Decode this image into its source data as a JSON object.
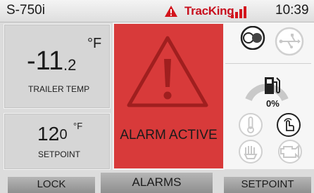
{
  "status_bar": {
    "model": "S-750i",
    "brand": "TracKing",
    "time": "10:39"
  },
  "trailer_temp": {
    "value_whole": "-11",
    "value_decimal": ".2",
    "unit": "°F",
    "label": "TRAILER TEMP"
  },
  "setpoint": {
    "value_whole": "12",
    "value_decimal": ".0",
    "unit": "°F",
    "label": "SETPOINT"
  },
  "alarm": {
    "text": "ALARM ACTIVE"
  },
  "fuel": {
    "percent": "0%",
    "level": 0
  },
  "icons": {
    "status_bar": [
      "alert-triangle-icon",
      "signal-bars-icon"
    ],
    "right_panel": [
      "toggle-icon",
      "usb-icon",
      "fuel-pump-icon",
      "thermometer-icon",
      "touch-icon",
      "defrost-icon",
      "engine-icon"
    ]
  },
  "buttons": {
    "lock": "LOCK",
    "alarms": "ALARMS",
    "setpoint": "SETPOINT"
  },
  "colors": {
    "alarm_red": "#d83a3a",
    "brand_red": "#c8101e",
    "background": "#dcdcdc"
  }
}
